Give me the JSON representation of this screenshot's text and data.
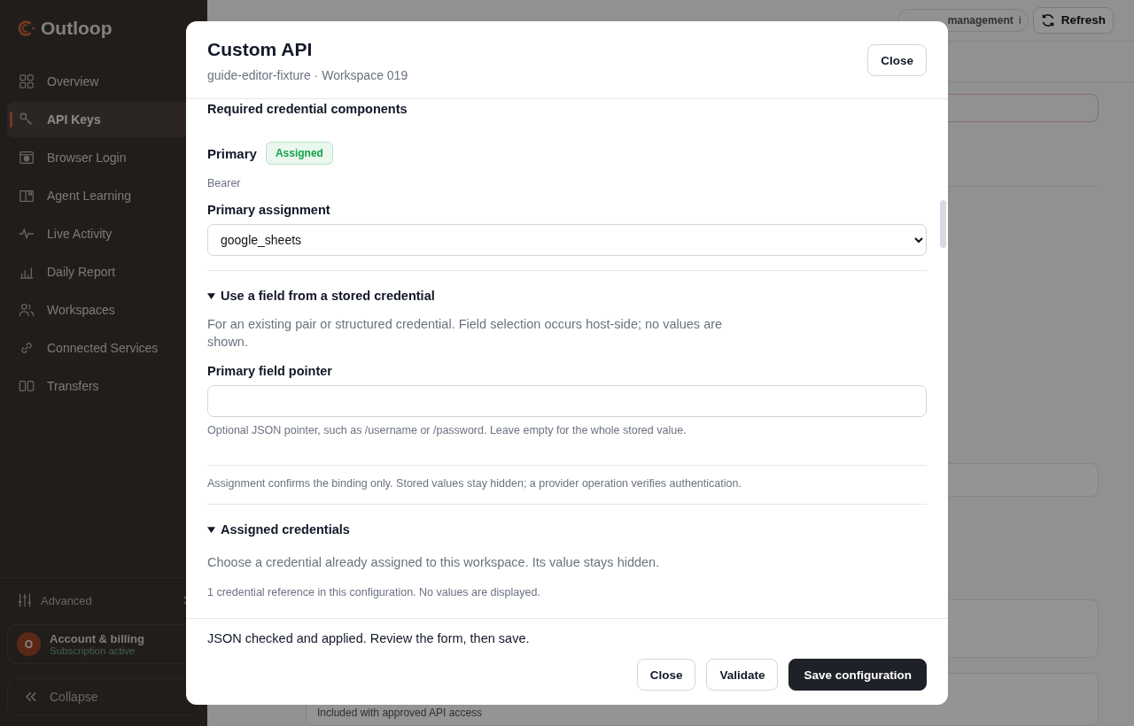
{
  "sidebar": {
    "brand": "Outloop",
    "items": [
      {
        "label": "Overview",
        "selected": false
      },
      {
        "label": "API Keys",
        "selected": true
      },
      {
        "label": "Browser Login",
        "selected": false
      },
      {
        "label": "Agent Learning",
        "selected": false
      },
      {
        "label": "Live Activity",
        "selected": false
      },
      {
        "label": "Daily Report",
        "selected": false
      },
      {
        "label": "Workspaces",
        "selected": false
      },
      {
        "label": "Connected Services",
        "selected": false
      },
      {
        "label": "Transfers",
        "selected": false
      }
    ],
    "advanced": "Advanced",
    "account": {
      "initial": "O",
      "title": "Account & billing",
      "status": "Subscription active"
    },
    "collapse": "Collapse"
  },
  "background": {
    "badge": "management",
    "badge_info": "i",
    "refresh": "Refresh",
    "card_text": "Included with approved API access"
  },
  "modal": {
    "title": "Custom API",
    "subtitle": "guide-editor-fixture · Workspace 019",
    "close": "Close",
    "section_title": "Required credential components",
    "component": {
      "name": "Primary",
      "status": "Assigned",
      "type": "Bearer"
    },
    "assignment": {
      "label": "Primary assignment",
      "value": "google_sheets"
    },
    "stored_field": {
      "title": "Use a field from a stored credential",
      "expanded": true,
      "description": "For an existing pair or structured credential. Field selection occurs host-side; no values are shown.",
      "pointer_label": "Primary field pointer",
      "hint": "Optional JSON pointer, such as /username or /password. Leave empty for the whole stored value."
    },
    "note": "Assignment confirms the binding only. Stored values stay hidden; a provider operation verifies authentication.",
    "assigned": {
      "title": "Assigned credentials",
      "expanded": true,
      "description": "Choose a credential already assigned to this workspace. Its value stays hidden.",
      "count": "1 credential reference in this configuration. No values are displayed."
    },
    "footer": {
      "message": "JSON checked and applied. Review the form, then save.",
      "buttons": [
        {
          "label": "Close",
          "kind": "secondary"
        },
        {
          "label": "Validate",
          "kind": "secondary"
        },
        {
          "label": "Save configuration",
          "kind": "primary"
        }
      ]
    }
  }
}
